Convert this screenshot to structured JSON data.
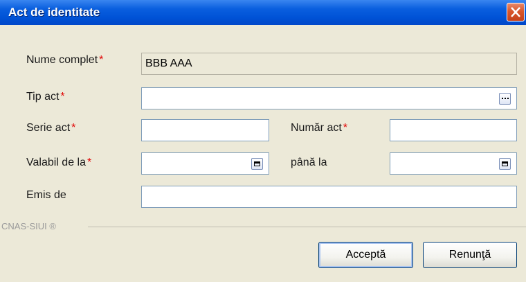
{
  "dialog": {
    "title": "Act de identitate"
  },
  "form": {
    "full_name": {
      "label": "Nume complet",
      "required": "*",
      "value": "BBB AAA"
    },
    "doc_type": {
      "label": "Tip act",
      "required": "*",
      "value": ""
    },
    "series": {
      "label": "Serie act",
      "required": "*",
      "value": ""
    },
    "number": {
      "label": "Număr act",
      "required": "*",
      "value": ""
    },
    "valid_from": {
      "label": "Valabil de la",
      "required": "*",
      "value": ""
    },
    "valid_to": {
      "label": "până la",
      "value": ""
    },
    "issued_by": {
      "label": "Emis de",
      "value": ""
    }
  },
  "footer": {
    "brand": "CNAS-SIUI ®",
    "accept_label": "Acceptă",
    "cancel_label": "Renunţă"
  },
  "icons": {
    "close": "close-icon",
    "browse": "ellipsis-icon",
    "date_picker": "calendar-icon"
  },
  "colors": {
    "titlebar": "#0a5fdf",
    "close_button": "#d9572c",
    "required_marker": "#e00000",
    "dialog_background": "#ece9d8"
  }
}
